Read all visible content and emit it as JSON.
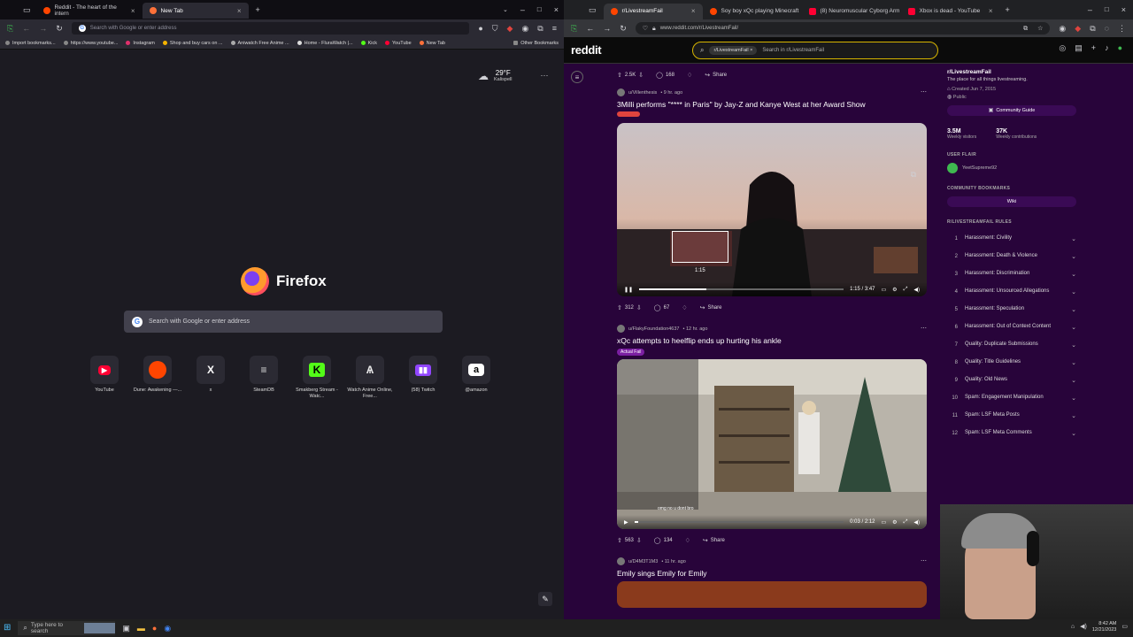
{
  "firefox": {
    "tabs": [
      {
        "title": "Reddit - The heart of the intern",
        "active": false,
        "color": "#ff4500"
      },
      {
        "title": "New Tab",
        "active": true,
        "color": "#ff7139"
      }
    ],
    "url_placeholder": "Search with Google or enter address",
    "bookmarks": [
      "Import bookmarks...",
      "https://www.youtube...",
      "Instagram",
      "Shop and buy cars on ...",
      "Aniwatch Free Anime ...",
      "Home - FluraWatch |...",
      "Kick",
      "YouTube",
      "New Tab"
    ],
    "other_bookmarks": "Other Bookmarks",
    "weather": {
      "temp": "29°F",
      "location": "Kalispell"
    },
    "brand": "Firefox",
    "search_placeholder": "Search with Google or enter address",
    "shortcuts": [
      {
        "label": "YouTube",
        "icon": "youtube-icon",
        "glyph": "▶",
        "color": "#ff0033"
      },
      {
        "label": "Dune: Awakening —...",
        "icon": "reddit-icon",
        "glyph": "●",
        "color": "#ff4500"
      },
      {
        "label": "x",
        "icon": "x-icon",
        "glyph": "X",
        "color": "#ffffff"
      },
      {
        "label": "SteamDB",
        "icon": "steamdb-icon",
        "glyph": "≡",
        "color": "#dddddd"
      },
      {
        "label": "Smakberg Stream - Watc...",
        "icon": "kick-icon",
        "glyph": "K",
        "color": "#53fc18"
      },
      {
        "label": "Watch Anime Online, Free...",
        "icon": "anime-icon",
        "glyph": "A",
        "color": "#e9e9e9"
      },
      {
        "label": "(58) Twitch",
        "icon": "twitch-icon",
        "glyph": "▮",
        "color": "#9146ff"
      },
      {
        "label": "@amazon",
        "icon": "amazon-icon",
        "glyph": "a",
        "color": "#ffffff"
      }
    ]
  },
  "chrome": {
    "tabs": [
      {
        "title": "r/LivestreamFail",
        "active": true,
        "color": "#ff4500"
      },
      {
        "title": "Soy boy xQc playing Minecraft",
        "active": false,
        "color": "#ff4500"
      },
      {
        "title": "(8) Neuromuscular Cyborg Arm",
        "active": false,
        "color": "#ff0033"
      },
      {
        "title": "Xbox is dead - YouTube",
        "active": false,
        "color": "#ff0033"
      }
    ],
    "url": "www.reddit.com/r/LivestreamFail/"
  },
  "reddit": {
    "logo": "reddit",
    "search_chip": "r/LivestreamFail",
    "search_placeholder": "Search in r/LivestreamFail",
    "posts": [
      {
        "votes": "2.5K",
        "comments": "168",
        "share": "Share"
      },
      {
        "author": "u/Villenthesis",
        "age": "• 9 hr. ago",
        "title": "3Milli performs \"**** in Paris\" by Jay-Z and Kanye West at her Award Show",
        "time": "1:15 / 3:47",
        "hover_time": "1:15",
        "progress": 0.33,
        "votes": "312",
        "comments": "67",
        "share": "Share"
      },
      {
        "author": "u/FlakyFoundation4637",
        "age": "• 12 hr. ago",
        "title": "xQc attempts to heelflip ends up hurting his ankle",
        "flair": "Actual Fail",
        "time": "0:03 / 2:12",
        "progress": 0.02,
        "chat_line": "omg no u dont bro",
        "votes": "563",
        "comments": "134",
        "share": "Share"
      },
      {
        "author": "u/D4M3T1M3",
        "age": "• 11 hr. ago",
        "title": "Emily sings Emily for Emily"
      }
    ],
    "sidebar": {
      "name": "r/LivestreamFail",
      "description": "The place for all things livestreaming.",
      "created": "Created Jun 7, 2015",
      "visibility": "Public",
      "guide_button": "Community Guide",
      "stats": [
        {
          "value": "3.5M",
          "label": "Weekly visitors"
        },
        {
          "value": "37K",
          "label": "Weekly contributions"
        }
      ],
      "flair_heading": "USER FLAIR",
      "flair_user": "YeetSupreme92",
      "bookmarks_heading": "COMMUNITY BOOKMARKS",
      "wiki": "Wiki",
      "rules_heading": "R/LIVESTREAMFAIL RULES",
      "rules": [
        {
          "n": "1",
          "t": "Harassment: Civility"
        },
        {
          "n": "2",
          "t": "Harassment: Death & Violence"
        },
        {
          "n": "3",
          "t": "Harassment: Discrimination"
        },
        {
          "n": "4",
          "t": "Harassment: Unsourced Allegations"
        },
        {
          "n": "5",
          "t": "Harassment: Speculation"
        },
        {
          "n": "6",
          "t": "Harassment: Out of Context Content"
        },
        {
          "n": "7",
          "t": "Quality: Duplicate Submissions"
        },
        {
          "n": "8",
          "t": "Quality: Title Guidelines"
        },
        {
          "n": "9",
          "t": "Quality: Old News"
        },
        {
          "n": "10",
          "t": "Spam: Engagement Manipulation"
        },
        {
          "n": "11",
          "t": "Spam: LSF Meta Posts"
        },
        {
          "n": "12",
          "t": "Spam: LSF Meta Comments"
        }
      ]
    }
  },
  "taskbar": {
    "search_placeholder": "Type here to search",
    "time": "8:42 AM",
    "date": "12/21/2023"
  }
}
